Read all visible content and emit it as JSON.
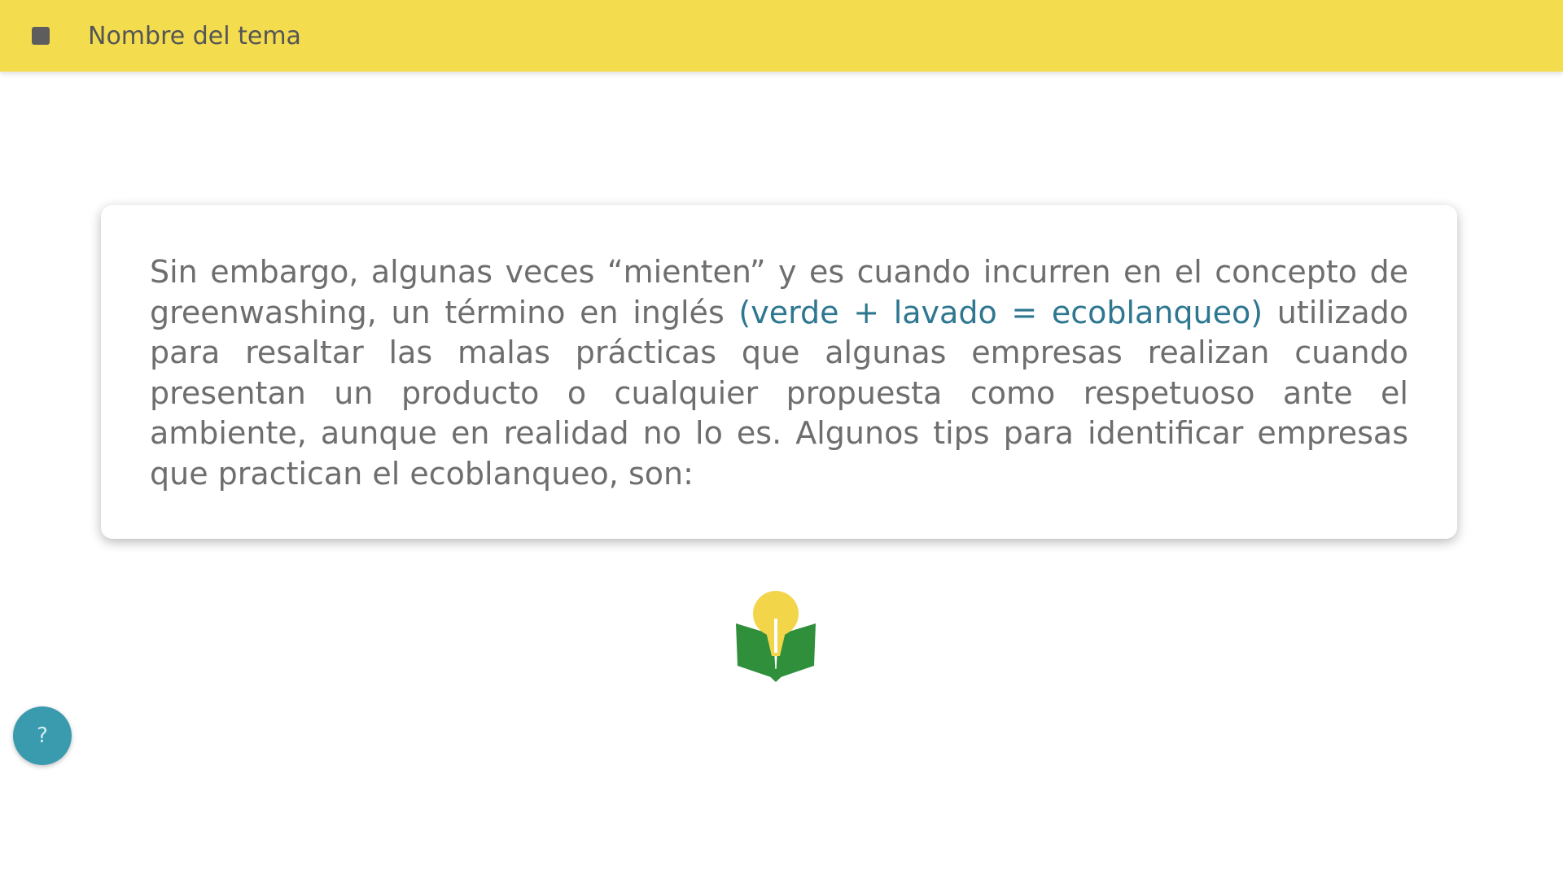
{
  "header": {
    "title": "Nombre del tema",
    "menu_icon": "menu-icon",
    "color": "#f3dd4f"
  },
  "card": {
    "text_before": "Sin embargo, algunas veces “mienten” y es cuando incurren en el concepto de greenwashing, un término en inglés ",
    "highlight": "(verde + lavado = ecoblanqueo)",
    "text_after": " utilizado para resaltar las malas prácticas que algunas empresas realizan cuando presentan un producto o cualquier propuesta como respetuoso ante el ambiente, aunque en realidad no lo es. Algunos tips para identificar empresas que practican el ecoblanqueo, son:",
    "highlight_color": "#2e7790"
  },
  "logo": {
    "icon": "lightbulb-book-logo",
    "colors": {
      "bulb": "#f3d54a",
      "book": "#2f8f3a"
    }
  },
  "help_button": {
    "icon": "help-icon",
    "label": "?",
    "color": "#3a9aae"
  }
}
